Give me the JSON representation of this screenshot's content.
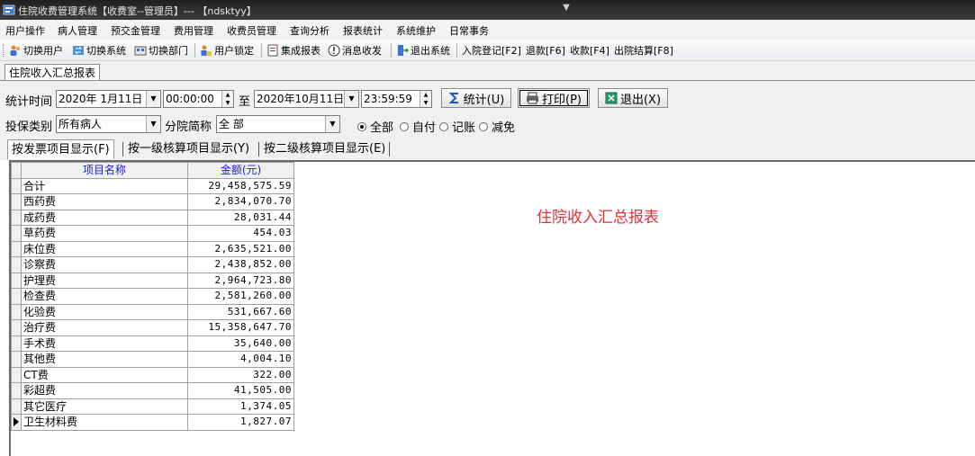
{
  "window": {
    "title": "住院收费管理系统【收费室--管理员】--- 【ndsktyy】"
  },
  "menu": [
    "用户操作",
    "病人管理",
    "预交金管理",
    "费用管理",
    "收费员管理",
    "查询分析",
    "报表统计",
    "系统维护",
    "日常事务"
  ],
  "toolbar": {
    "switch_user": "切换用户",
    "switch_system": "切换系统",
    "switch_dept": "切换部门",
    "user_lock": "用户锁定",
    "integrated_report": "集成报表",
    "message": "消息收发",
    "exit_system": "退出系统",
    "admission": "入院登记[F2]",
    "refund": "退款[F6]",
    "payment": "收款[F4]",
    "discharge": "出院结算[F8]"
  },
  "doc_tab": "住院收入汇总报表",
  "filters": {
    "time_label": "统计时间",
    "start_date": "2020年 1月11日",
    "start_time": "00:00:00",
    "to_label": "至",
    "end_date": "2020年10月11日",
    "end_time": "23:59:59",
    "insurance_label": "投保类别",
    "insurance_value": "所有病人",
    "branch_label": "分院简称",
    "branch_value": "全 部",
    "radio_all": "全部",
    "radio_self": "自付",
    "radio_account": "记账",
    "radio_waive": "减免",
    "radio_selected": "全部"
  },
  "buttons": {
    "stats": "统计(U)",
    "print": "打印(P)",
    "exit": "退出(X)"
  },
  "subtabs": [
    "按发票项目显示(F)",
    "按一级核算项目显示(Y)",
    "按二级核算项目显示(E)"
  ],
  "grid": {
    "columns": [
      "项目名称",
      "金额(元)"
    ],
    "rows": [
      {
        "name": " 合计",
        "amount": "29,458,575.59"
      },
      {
        "name": "西药费",
        "amount": "2,834,070.70"
      },
      {
        "name": "成药费",
        "amount": "28,031.44"
      },
      {
        "name": "草药费",
        "amount": "454.03"
      },
      {
        "name": "床位费",
        "amount": "2,635,521.00"
      },
      {
        "name": "诊察费",
        "amount": "2,438,852.00"
      },
      {
        "name": "护理费",
        "amount": "2,964,723.80"
      },
      {
        "name": "检查费",
        "amount": "2,581,260.00"
      },
      {
        "name": "化验费",
        "amount": "531,667.60"
      },
      {
        "name": "治疗费",
        "amount": "15,358,647.70"
      },
      {
        "name": "手术费",
        "amount": "35,640.00"
      },
      {
        "name": "其他费",
        "amount": "4,004.10"
      },
      {
        "name": "CT费",
        "amount": "322.00"
      },
      {
        "name": "彩超费",
        "amount": "41,505.00"
      },
      {
        "name": "其它医疗",
        "amount": "1,374.05"
      },
      {
        "name": "卫生材料费",
        "amount": "1,827.07"
      }
    ]
  },
  "report_title": "住院收入汇总报表",
  "colors": {
    "title_red": "#e0303a",
    "header_blue": "#1a1ae0"
  }
}
